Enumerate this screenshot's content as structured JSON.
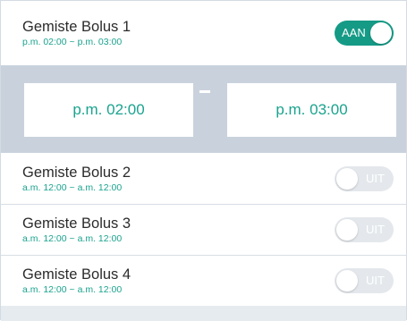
{
  "bolus_items": [
    {
      "title": "Gemiste Bolus 1",
      "range": "p.m. 02:00 ~ p.m. 03:00",
      "toggle_label": "AAN",
      "enabled": true
    },
    {
      "title": "Gemiste Bolus 2",
      "range": "a.m. 12:00 ~ a.m. 12:00",
      "toggle_label": "UIT",
      "enabled": false
    },
    {
      "title": "Gemiste Bolus 3",
      "range": "a.m. 12:00 ~ a.m. 12:00",
      "toggle_label": "UIT",
      "enabled": false
    },
    {
      "title": "Gemiste Bolus 4",
      "range": "a.m. 12:00 ~ a.m. 12:00",
      "toggle_label": "UIT",
      "enabled": false
    }
  ],
  "time_picker": {
    "start": "p.m. 02:00",
    "end": "p.m. 03:00"
  },
  "colors": {
    "accent": "#159a86",
    "panel": "#c9d2dc",
    "toggle_off": "#e4e8ec"
  }
}
